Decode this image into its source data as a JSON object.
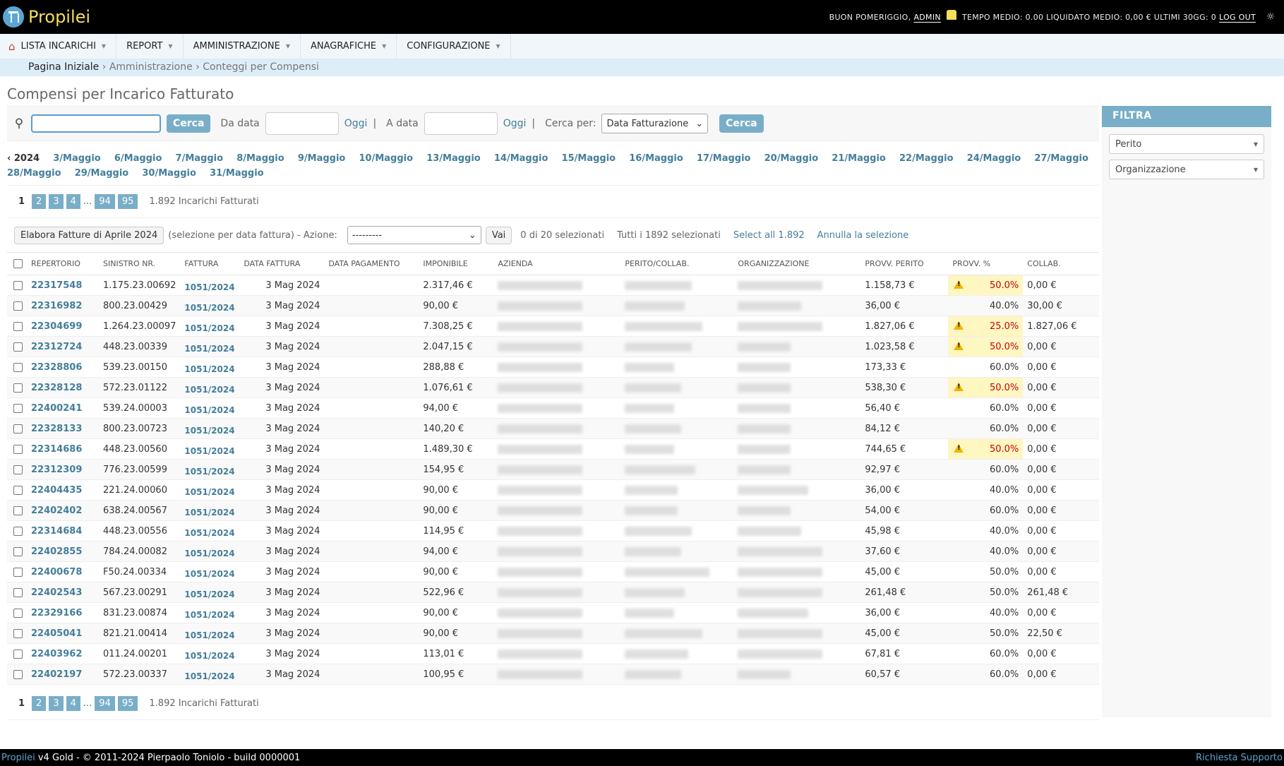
{
  "header": {
    "app_name": "Propilei",
    "greeting": "BUON POMERIGGIO,",
    "user": "ADMIN",
    "stats": "TEMPO MEDIO: 0.00 LIQUIDATO MEDIO: 0,00 € ULTIMI 30GG: 0",
    "logout": "LOG OUT"
  },
  "nav": {
    "items": [
      {
        "label": "LISTA INCARICHI"
      },
      {
        "label": "REPORT"
      },
      {
        "label": "AMMINISTRAZIONE"
      },
      {
        "label": "ANAGRAFICHE"
      },
      {
        "label": "CONFIGURAZIONE"
      }
    ]
  },
  "breadcrumbs": {
    "home": "Pagina Iniziale",
    "sep": "›",
    "level1": "Amministrazione",
    "level2": "Conteggi per Compensi"
  },
  "page": {
    "title": "Compensi per Incarico Fatturato"
  },
  "search": {
    "button": "Cerca",
    "from_label": "Da data",
    "to_label": "A data",
    "today": "Oggi",
    "pipe": "|",
    "search_by_label": "Cerca per:",
    "search_by_value": "Data Fatturazione",
    "button2": "Cerca"
  },
  "date_hierarchy": {
    "back": "‹ 2024",
    "days": [
      "3/Maggio",
      "6/Maggio",
      "7/Maggio",
      "8/Maggio",
      "9/Maggio",
      "10/Maggio",
      "13/Maggio",
      "14/Maggio",
      "15/Maggio",
      "16/Maggio",
      "17/Maggio",
      "20/Maggio",
      "21/Maggio",
      "22/Maggio",
      "24/Maggio",
      "27/Maggio",
      "28/Maggio",
      "29/Maggio",
      "30/Maggio",
      "31/Maggio"
    ]
  },
  "paginator": {
    "current": "1",
    "pages": [
      "2",
      "3",
      "4"
    ],
    "ellipsis": "...",
    "last_pages": [
      "94",
      "95"
    ],
    "count": "1.892 Incarichi Fatturati"
  },
  "actions": {
    "elabora": "Elabora Fatture di Aprile 2024",
    "note": "(selezione per data fattura) - Azione:",
    "select_value": "---------",
    "go": "Vai",
    "counter": "0 di 20 selezionati",
    "all_selected": "Tutti i 1892 selezionati",
    "select_all": "Select all 1.892",
    "clear": "Annulla la selezione"
  },
  "table": {
    "headers": [
      "REPERTORIO",
      "SINISTRO NR.",
      "FATTURA",
      "DATA FATTURA",
      "DATA PAGAMENTO",
      "IMPONIBILE",
      "AZIENDA",
      "PERITO/COLLAB.",
      "ORGANIZZAZIONE",
      "PROVV. PERITO",
      "PROVV. %",
      "COLLAB."
    ],
    "rows": [
      {
        "rep": "22317548",
        "sin": "1.175.23.00692",
        "fatt": "1051/2024",
        "data": "3 Mag 2024",
        "imp": "2.317,46 €",
        "provv": "1.158,73 €",
        "pct": "50.0%",
        "warn": true,
        "collab": "0,00 €"
      },
      {
        "rep": "22316982",
        "sin": "800.23.00429",
        "fatt": "1051/2024",
        "data": "3 Mag 2024",
        "imp": "90,00 €",
        "provv": "36,00 €",
        "pct": "40.0%",
        "warn": false,
        "collab": "30,00 €"
      },
      {
        "rep": "22304699",
        "sin": "1.264.23.00097",
        "fatt": "1051/2024",
        "data": "3 Mag 2024",
        "imp": "7.308,25 €",
        "provv": "1.827,06 €",
        "pct": "25.0%",
        "warn": true,
        "collab": "1.827,06 €"
      },
      {
        "rep": "22312724",
        "sin": "448.23.00339",
        "fatt": "1051/2024",
        "data": "3 Mag 2024",
        "imp": "2.047,15 €",
        "provv": "1.023,58 €",
        "pct": "50.0%",
        "warn": true,
        "collab": "0,00 €"
      },
      {
        "rep": "22328806",
        "sin": "539.23.00150",
        "fatt": "1051/2024",
        "data": "3 Mag 2024",
        "imp": "288,88 €",
        "provv": "173,33 €",
        "pct": "60.0%",
        "warn": false,
        "collab": "0,00 €"
      },
      {
        "rep": "22328128",
        "sin": "572.23.01122",
        "fatt": "1051/2024",
        "data": "3 Mag 2024",
        "imp": "1.076,61 €",
        "provv": "538,30 €",
        "pct": "50.0%",
        "warn": true,
        "collab": "0,00 €"
      },
      {
        "rep": "22400241",
        "sin": "539.24.00003",
        "fatt": "1051/2024",
        "data": "3 Mag 2024",
        "imp": "94,00 €",
        "provv": "56,40 €",
        "pct": "60.0%",
        "warn": false,
        "collab": "0,00 €"
      },
      {
        "rep": "22328133",
        "sin": "800.23.00723",
        "fatt": "1051/2024",
        "data": "3 Mag 2024",
        "imp": "140,20 €",
        "provv": "84,12 €",
        "pct": "60.0%",
        "warn": false,
        "collab": "0,00 €"
      },
      {
        "rep": "22314686",
        "sin": "448.23.00560",
        "fatt": "1051/2024",
        "data": "3 Mag 2024",
        "imp": "1.489,30 €",
        "provv": "744,65 €",
        "pct": "50.0%",
        "warn": true,
        "collab": "0,00 €"
      },
      {
        "rep": "22312309",
        "sin": "776.23.00599",
        "fatt": "1051/2024",
        "data": "3 Mag 2024",
        "imp": "154,95 €",
        "provv": "92,97 €",
        "pct": "60.0%",
        "warn": false,
        "collab": "0,00 €"
      },
      {
        "rep": "22404435",
        "sin": "221.24.00060",
        "fatt": "1051/2024",
        "data": "3 Mag 2024",
        "imp": "90,00 €",
        "provv": "36,00 €",
        "pct": "40.0%",
        "warn": false,
        "collab": "0,00 €"
      },
      {
        "rep": "22402402",
        "sin": "638.24.00567",
        "fatt": "1051/2024",
        "data": "3 Mag 2024",
        "imp": "90,00 €",
        "provv": "54,00 €",
        "pct": "60.0%",
        "warn": false,
        "collab": "0,00 €"
      },
      {
        "rep": "22314684",
        "sin": "448.23.00556",
        "fatt": "1051/2024",
        "data": "3 Mag 2024",
        "imp": "114,95 €",
        "provv": "45,98 €",
        "pct": "40.0%",
        "warn": false,
        "collab": "0,00 €"
      },
      {
        "rep": "22402855",
        "sin": "784.24.00082",
        "fatt": "1051/2024",
        "data": "3 Mag 2024",
        "imp": "94,00 €",
        "provv": "37,60 €",
        "pct": "40.0%",
        "warn": false,
        "collab": "0,00 €"
      },
      {
        "rep": "22400678",
        "sin": "F50.24.00334",
        "fatt": "1051/2024",
        "data": "3 Mag 2024",
        "imp": "90,00 €",
        "provv": "45,00 €",
        "pct": "50.0%",
        "warn": false,
        "collab": "0,00 €"
      },
      {
        "rep": "22402543",
        "sin": "567.23.00291",
        "fatt": "1051/2024",
        "data": "3 Mag 2024",
        "imp": "522,96 €",
        "provv": "261,48 €",
        "pct": "50.0%",
        "warn": false,
        "collab": "261,48 €"
      },
      {
        "rep": "22329166",
        "sin": "831.23.00874",
        "fatt": "1051/2024",
        "data": "3 Mag 2024",
        "imp": "90,00 €",
        "provv": "36,00 €",
        "pct": "40.0%",
        "warn": false,
        "collab": "0,00 €"
      },
      {
        "rep": "22405041",
        "sin": "821.21.00414",
        "fatt": "1051/2024",
        "data": "3 Mag 2024",
        "imp": "90,00 €",
        "provv": "45,00 €",
        "pct": "50.0%",
        "warn": false,
        "collab": "22,50 €"
      },
      {
        "rep": "22403962",
        "sin": "011.24.00201",
        "fatt": "1051/2024",
        "data": "3 Mag 2024",
        "imp": "113,01 €",
        "provv": "67,81 €",
        "pct": "60.0%",
        "warn": false,
        "collab": "0,00 €"
      },
      {
        "rep": "22402197",
        "sin": "572.23.00337",
        "fatt": "1051/2024",
        "data": "3 Mag 2024",
        "imp": "100,95 €",
        "provv": "60,57 €",
        "pct": "60.0%",
        "warn": false,
        "collab": "0,00 €"
      }
    ]
  },
  "filter": {
    "title": "FILTRA",
    "perito": "Perito",
    "organizzazione": "Organizzazione"
  },
  "footer": {
    "brand": "Propilei",
    "text": " v4 Gold - © 2011-2024 Pierpaolo Toniolo - build 0000001",
    "support": "Richiesta Supporto"
  },
  "colors": {
    "header_bg": "#000000",
    "brand": "#f5dd5d",
    "accent": "#79aec8",
    "link": "#447e9b",
    "warn_bg": "#fff7c2",
    "warn_text": "#cc0000"
  }
}
